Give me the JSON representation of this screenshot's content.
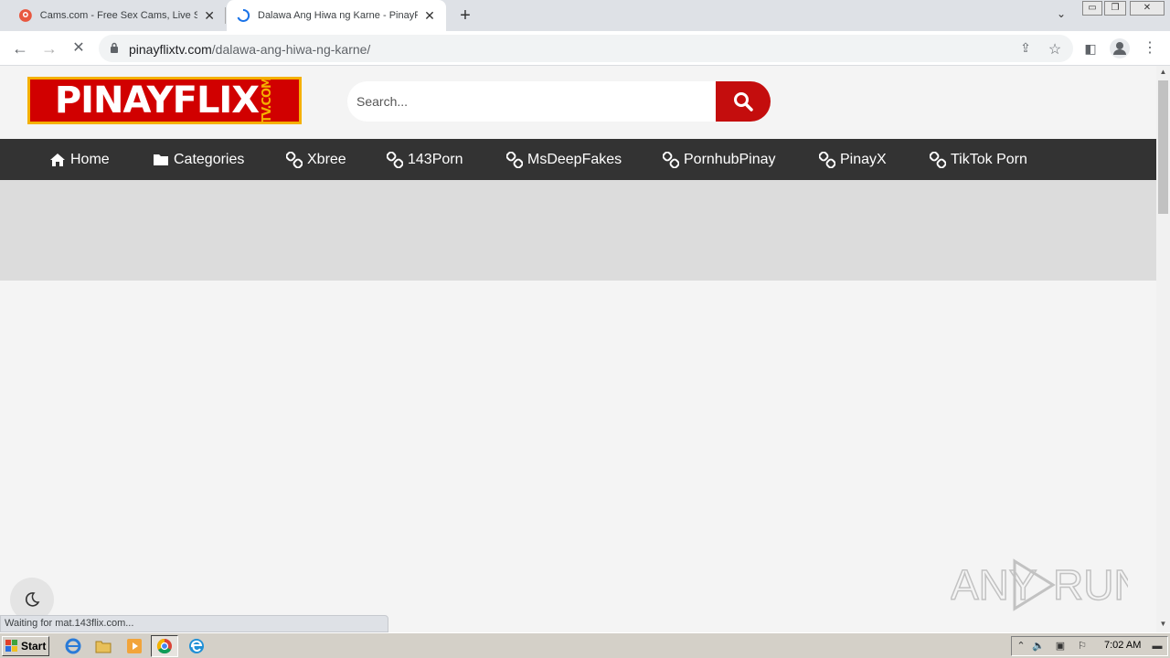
{
  "browser": {
    "tabs": [
      {
        "title": "Cams.com - Free Sex Cams, Live Sex",
        "close": "✕"
      },
      {
        "title": "Dalawa Ang Hiwa ng Karne - PinayFlix",
        "close": "✕"
      }
    ],
    "new_tab": "+",
    "tab_search": "⌄",
    "window_controls": [
      "▭",
      "❐",
      "✕"
    ],
    "nav": {
      "back": "←",
      "forward": "→",
      "reload": "✕"
    },
    "url": {
      "host": "pinayflixtv.com",
      "path": "/dalawa-ang-hiwa-ng-karne/"
    },
    "toolbar_icons": {
      "share": "⇪",
      "bookmark": "☆",
      "sidepanel": "◧",
      "menu": "⋮"
    }
  },
  "site": {
    "logo": {
      "text": "PINAYFLIX",
      "suffix": "TV.COM"
    },
    "search": {
      "placeholder": "Search..."
    },
    "nav": [
      {
        "label": "Home",
        "icon": "home-icon"
      },
      {
        "label": "Categories",
        "icon": "folder-icon"
      },
      {
        "label": "Xbree",
        "icon": "link-icon"
      },
      {
        "label": "143Porn",
        "icon": "link-icon"
      },
      {
        "label": "MsDeepFakes",
        "icon": "link-icon"
      },
      {
        "label": "PornhubPinay",
        "icon": "link-icon"
      },
      {
        "label": "PinayX",
        "icon": "link-icon"
      },
      {
        "label": "TikTok Porn",
        "icon": "link-icon"
      }
    ]
  },
  "status": {
    "text": "Waiting for mat.143flix.com..."
  },
  "watermark": {
    "text": "ANY RUN"
  },
  "taskbar": {
    "start_label": "Start",
    "clock": "7:02 AM"
  },
  "colors": {
    "brand_red": "#c40d0d",
    "nav_bg": "#333333",
    "logo_gold": "#f5b000"
  }
}
